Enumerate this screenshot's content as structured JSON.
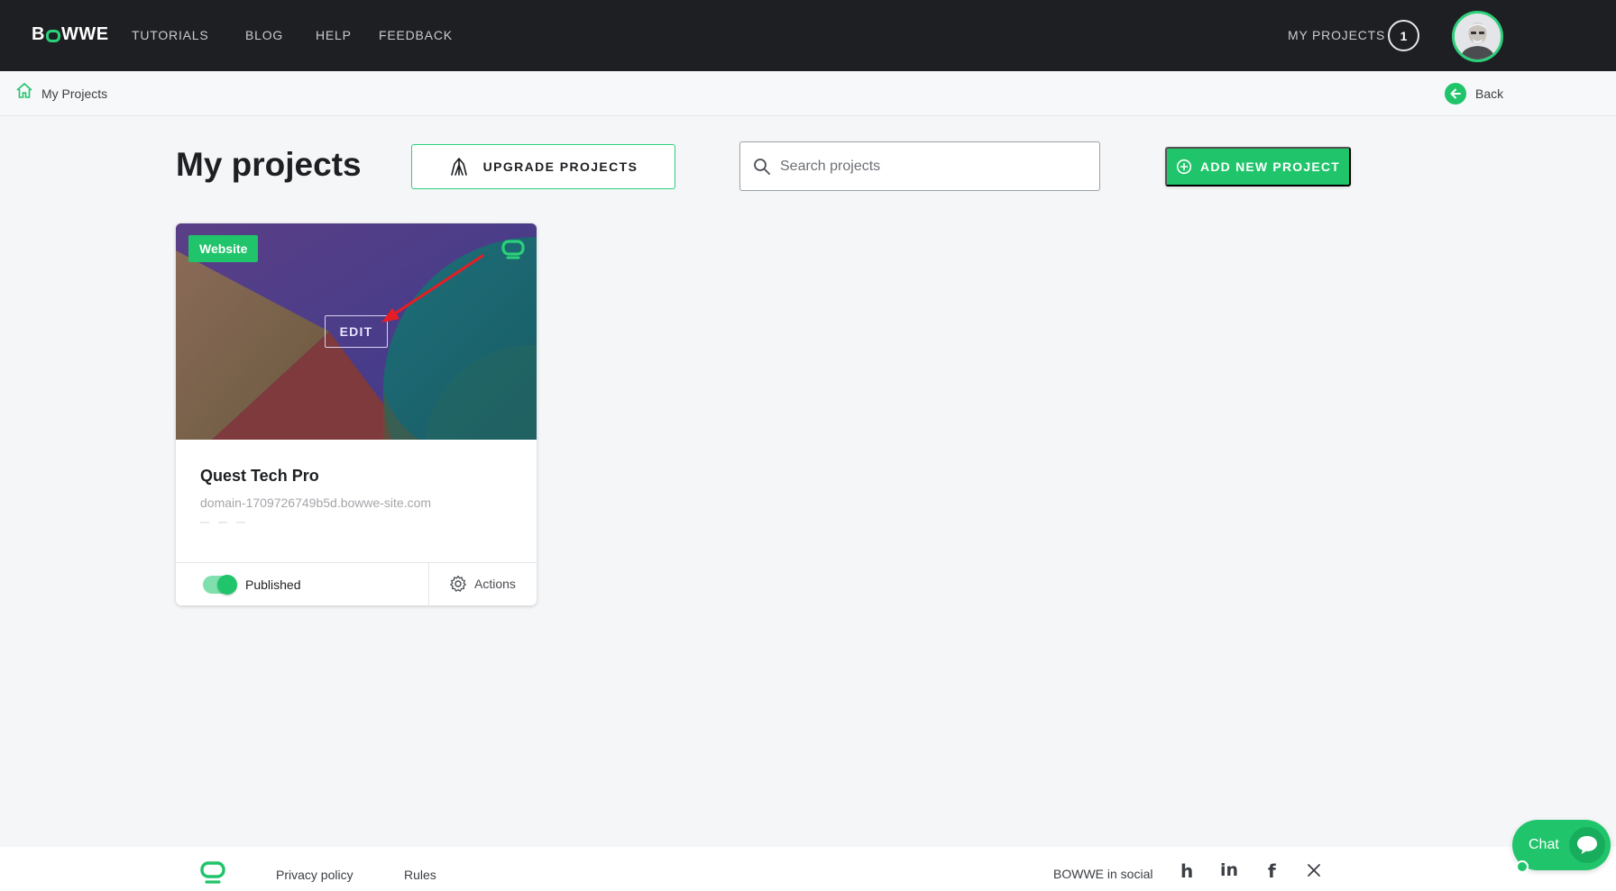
{
  "topnav": {
    "logo_pre": "B",
    "logo_post": "WWE",
    "links": [
      "TUTORIALS",
      "BLOG",
      "HELP",
      "FEEDBACK"
    ],
    "my_projects_label": "MY PROJECTS",
    "project_count": "1"
  },
  "breadcrumb": {
    "label": "My Projects",
    "back_label": "Back"
  },
  "header": {
    "title": "My projects",
    "upgrade_label": "UPGRADE PROJECTS",
    "search_placeholder": "Search projects",
    "add_label": "ADD NEW PROJECT"
  },
  "project": {
    "type_tag": "Website",
    "edit_label": "EDIT",
    "name": "Quest Tech Pro",
    "domain": "domain-1709726749b5d.bowwe-site.com",
    "status_label": "Published",
    "published": true,
    "actions_label": "Actions"
  },
  "footer": {
    "links": [
      "Privacy policy",
      "Rules"
    ],
    "social_label": "BOWWE in social",
    "social_icons": [
      "houzz-icon",
      "linkedin-icon",
      "facebook-icon",
      "x-icon"
    ]
  },
  "chat": {
    "label": "Chat"
  },
  "colors": {
    "accent": "#20c46a",
    "nav_bg": "#1e1f22",
    "page_bg": "#f5f6f8",
    "annotation": "#e81c24"
  }
}
